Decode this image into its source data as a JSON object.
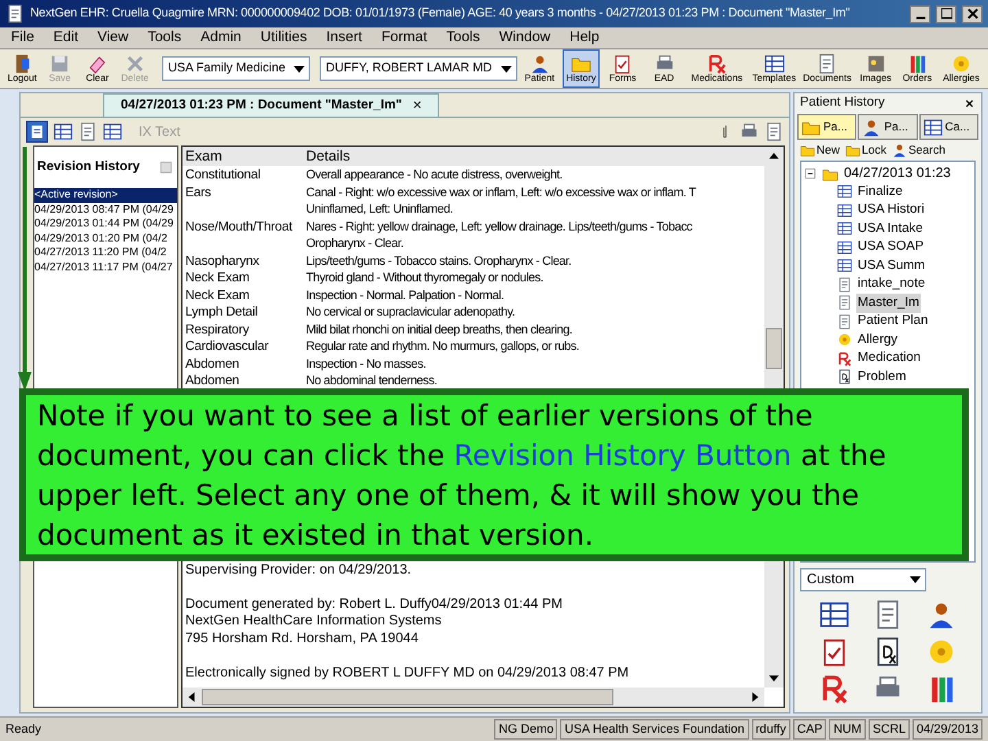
{
  "window": {
    "title": "NextGen EHR: Cruella Quagmire MRN: 000000009402 DOB: 01/01/1973 (Female) AGE: 40 years 3 months - 04/27/2013 01:23 PM : Document \"Master_Im\""
  },
  "menu": [
    "File",
    "Edit",
    "View",
    "Tools",
    "Admin",
    "Utilities",
    "Insert",
    "Format",
    "Tools",
    "Window",
    "Help"
  ],
  "toolbar": {
    "left": [
      {
        "label": "Logout",
        "disabled": false
      },
      {
        "label": "Save",
        "disabled": true
      },
      {
        "label": "Clear",
        "disabled": false
      },
      {
        "label": "Delete",
        "disabled": true
      }
    ],
    "practice": "USA Family Medicine",
    "provider": "DUFFY, ROBERT LAMAR MD",
    "right": [
      {
        "label": "Patient",
        "selected": false
      },
      {
        "label": "History",
        "selected": true
      },
      {
        "label": "Forms",
        "selected": false
      },
      {
        "label": "EAD",
        "selected": false
      },
      {
        "label": "Medications",
        "selected": false
      },
      {
        "label": "Templates",
        "selected": false
      },
      {
        "label": "Documents",
        "selected": false
      },
      {
        "label": "Images",
        "selected": false
      },
      {
        "label": "Orders",
        "selected": false
      },
      {
        "label": "Allergies",
        "selected": false
      }
    ]
  },
  "document_tab": {
    "title": "04/27/2013 01:23 PM  : Document \"Master_Im\"",
    "close": "×"
  },
  "document_toolbar": {
    "ix_text": "IX Text"
  },
  "revision_history": {
    "title": "Revision History",
    "items": [
      {
        "label": "<Active revision>",
        "selected": true
      },
      {
        "label": "04/29/2013 08:47 PM (04/29",
        "selected": false
      },
      {
        "label": "04/29/2013 01:44 PM (04/29",
        "selected": false
      },
      {
        "label": "04/29/2013 01:20 PM (04/2",
        "selected": false
      },
      {
        "label": "04/27/2013 11:20 PM (04/2",
        "selected": false
      },
      {
        "label": "04/27/2013 11:17 PM (04/27",
        "selected": false
      }
    ]
  },
  "exam_table": {
    "columns": [
      "Exam",
      "Details"
    ],
    "rows": [
      {
        "exam": "Constitutional",
        "details": "Overall appearance - No acute distress, overweight."
      },
      {
        "exam": "Ears",
        "details": "Canal - Right: w/o excessive wax or inflam, Left: w/o excessive wax or inflam. T"
      },
      {
        "exam": "",
        "details": "Uninflamed, Left: Uninflamed."
      },
      {
        "exam": "Nose/Mouth/Throat",
        "details": "Nares - Right: yellow drainage, Left: yellow drainage. Lips/teeth/gums - Tobacc"
      },
      {
        "exam": "",
        "details": "Oropharynx - Clear."
      },
      {
        "exam": "Nasopharynx",
        "details": "Lips/teeth/gums - Tobacco stains. Oropharynx - Clear."
      },
      {
        "exam": "Neck Exam",
        "details": "Thyroid gland - Without thyromegaly or nodules."
      },
      {
        "exam": "Neck Exam",
        "details": "Inspection - Normal. Palpation - Normal."
      },
      {
        "exam": "Lymph Detail",
        "details": "No cervical or supraclavicular adenopathy."
      },
      {
        "exam": "Respiratory",
        "details": "Mild bilat rhonchi on initial deep breaths, then clearing."
      },
      {
        "exam": "Cardiovascular",
        "details": "Regular rate and rhythm. No murmurs, gallops, or rubs."
      },
      {
        "exam": "Abdomen",
        "details": "Inspection - No masses."
      },
      {
        "exam": "Abdomen",
        "details": "No abdominal tenderness."
      }
    ]
  },
  "document_footer": [
    [
      "Supervising Provider:   on 04/29/2013."
    ],
    [
      "Document generated by: Robert L. Duffy04/29/2013 01:44 PM",
      "NextGen HealthCare Information Systems",
      "795 Horsham Rd.  Horsham, PA 19044"
    ],
    [
      "Electronically signed by ROBERT L DUFFY MD on 04/29/2013 08:47 PM"
    ]
  ],
  "patient_history": {
    "title": "Patient History",
    "tabs": [
      {
        "label": "Pa...",
        "selected": true
      },
      {
        "label": "Pa...",
        "selected": false
      },
      {
        "label": "Ca...",
        "selected": false
      }
    ],
    "actions": [
      "New",
      "Lock",
      "Search"
    ],
    "tree": [
      {
        "label": "04/27/2013 01:23",
        "expanded": true,
        "children": [
          {
            "label": "Finalize",
            "kind": "form",
            "selected": false
          },
          {
            "label": "USA Histori",
            "kind": "form",
            "selected": false
          },
          {
            "label": "USA Intake",
            "kind": "form",
            "selected": false
          },
          {
            "label": "USA SOAP",
            "kind": "form",
            "selected": false
          },
          {
            "label": "USA Summ",
            "kind": "form",
            "selected": false
          },
          {
            "label": "intake_note",
            "kind": "doc",
            "selected": false
          },
          {
            "label": "Master_Im",
            "kind": "doc",
            "selected": true
          },
          {
            "label": "Patient Plan",
            "kind": "doc",
            "selected": false
          },
          {
            "label": "Allergy",
            "kind": "allergy",
            "selected": false
          },
          {
            "label": "Medication",
            "kind": "rx",
            "selected": false
          },
          {
            "label": "Problem",
            "kind": "dx",
            "selected": false
          }
        ]
      }
    ],
    "view": "Custom"
  },
  "note": [
    {
      "kind": "plain",
      "text": "Note if you want to see a list of earlier versions of the document, you can click the "
    },
    {
      "kind": "highlight",
      "text": "Revision History Button"
    },
    {
      "kind": "plain",
      "text": " at the upper left.  Select any one of them, & it will show you the document as it existed in that version."
    }
  ],
  "status_bar": {
    "message": "Ready",
    "panes": [
      "NG Demo",
      "USA Health Services Foundation",
      "rduffy",
      "CAP",
      "NUM",
      "SCRL",
      "04/29/2013"
    ]
  }
}
